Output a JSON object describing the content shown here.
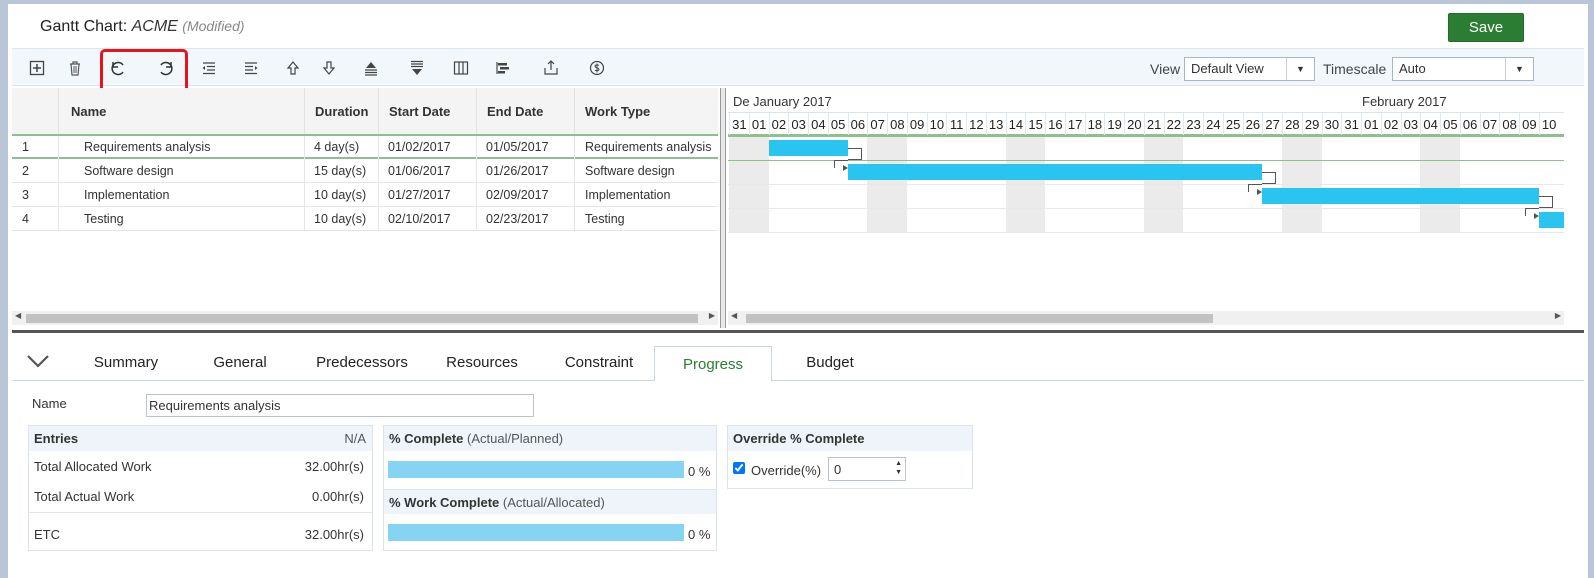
{
  "header": {
    "title_prefix": "Gantt Chart:",
    "project": "ACME",
    "modified": "(Modified)",
    "save_label": "Save"
  },
  "toolbar": {
    "icons": [
      "add-task-icon",
      "delete-icon",
      "undo-icon",
      "redo-icon",
      "outdent-icon",
      "indent-icon",
      "move-up-icon",
      "move-down-icon",
      "collapse-all-icon",
      "expand-all-icon",
      "columns-icon",
      "autoschedule-icon",
      "export-icon",
      "budget-icon"
    ],
    "view_label": "View",
    "view_value": "Default View",
    "timescale_label": "Timescale",
    "timescale_value": "Auto"
  },
  "grid": {
    "columns": [
      "Name",
      "Duration",
      "Start Date",
      "End Date",
      "Work Type"
    ],
    "rows": [
      {
        "id": "1",
        "name": "Requirements analysis",
        "duration": "4 day(s)",
        "start": "01/02/2017",
        "end": "01/05/2017",
        "work_type": "Requirements analysis"
      },
      {
        "id": "2",
        "name": "Software design",
        "duration": "15 day(s)",
        "start": "01/06/2017",
        "end": "01/26/2017",
        "work_type": "Software design"
      },
      {
        "id": "3",
        "name": "Implementation",
        "duration": "10 day(s)",
        "start": "01/27/2017",
        "end": "02/09/2017",
        "work_type": "Implementation"
      },
      {
        "id": "4",
        "name": "Testing",
        "duration": "10 day(s)",
        "start": "02/10/2017",
        "end": "02/23/2017",
        "work_type": "Testing"
      }
    ]
  },
  "gantt": {
    "months": [
      "De",
      "January 2017",
      "February 2017"
    ],
    "days": [
      "31",
      "01",
      "02",
      "03",
      "04",
      "05",
      "06",
      "07",
      "08",
      "09",
      "10",
      "11",
      "12",
      "13",
      "14",
      "15",
      "16",
      "17",
      "18",
      "19",
      "20",
      "21",
      "22",
      "23",
      "24",
      "25",
      "26",
      "27",
      "28",
      "29",
      "30",
      "31",
      "01",
      "02",
      "03",
      "04",
      "05",
      "06",
      "07",
      "08",
      "09",
      "10"
    ],
    "colors": {
      "bar": "#29c4ef",
      "weekend": "#ebebeb"
    }
  },
  "tabs": [
    "Summary",
    "General",
    "Predecessors",
    "Resources",
    "Constraint",
    "Progress",
    "Budget"
  ],
  "active_tab": "Progress",
  "details": {
    "name_label": "Name",
    "name_value": "Requirements analysis",
    "entries_title": "Entries",
    "entries_na": "N/A",
    "entries": [
      {
        "label": "Total Allocated Work",
        "value": "32.00hr(s)"
      },
      {
        "label": "Total Actual Work",
        "value": "0.00hr(s)"
      },
      {
        "label": "ETC",
        "value": "32.00hr(s)"
      }
    ],
    "pct_complete_title": "% Complete",
    "pct_complete_sub": "(Actual/Planned)",
    "pct_complete_value": "0 %",
    "pct_work_title": "% Work Complete",
    "pct_work_sub": "(Actual/Allocated)",
    "pct_work_value": "0 %",
    "override_title": "Override % Complete",
    "override_label": "Override(%)",
    "override_value": "0",
    "override_checked": true
  }
}
